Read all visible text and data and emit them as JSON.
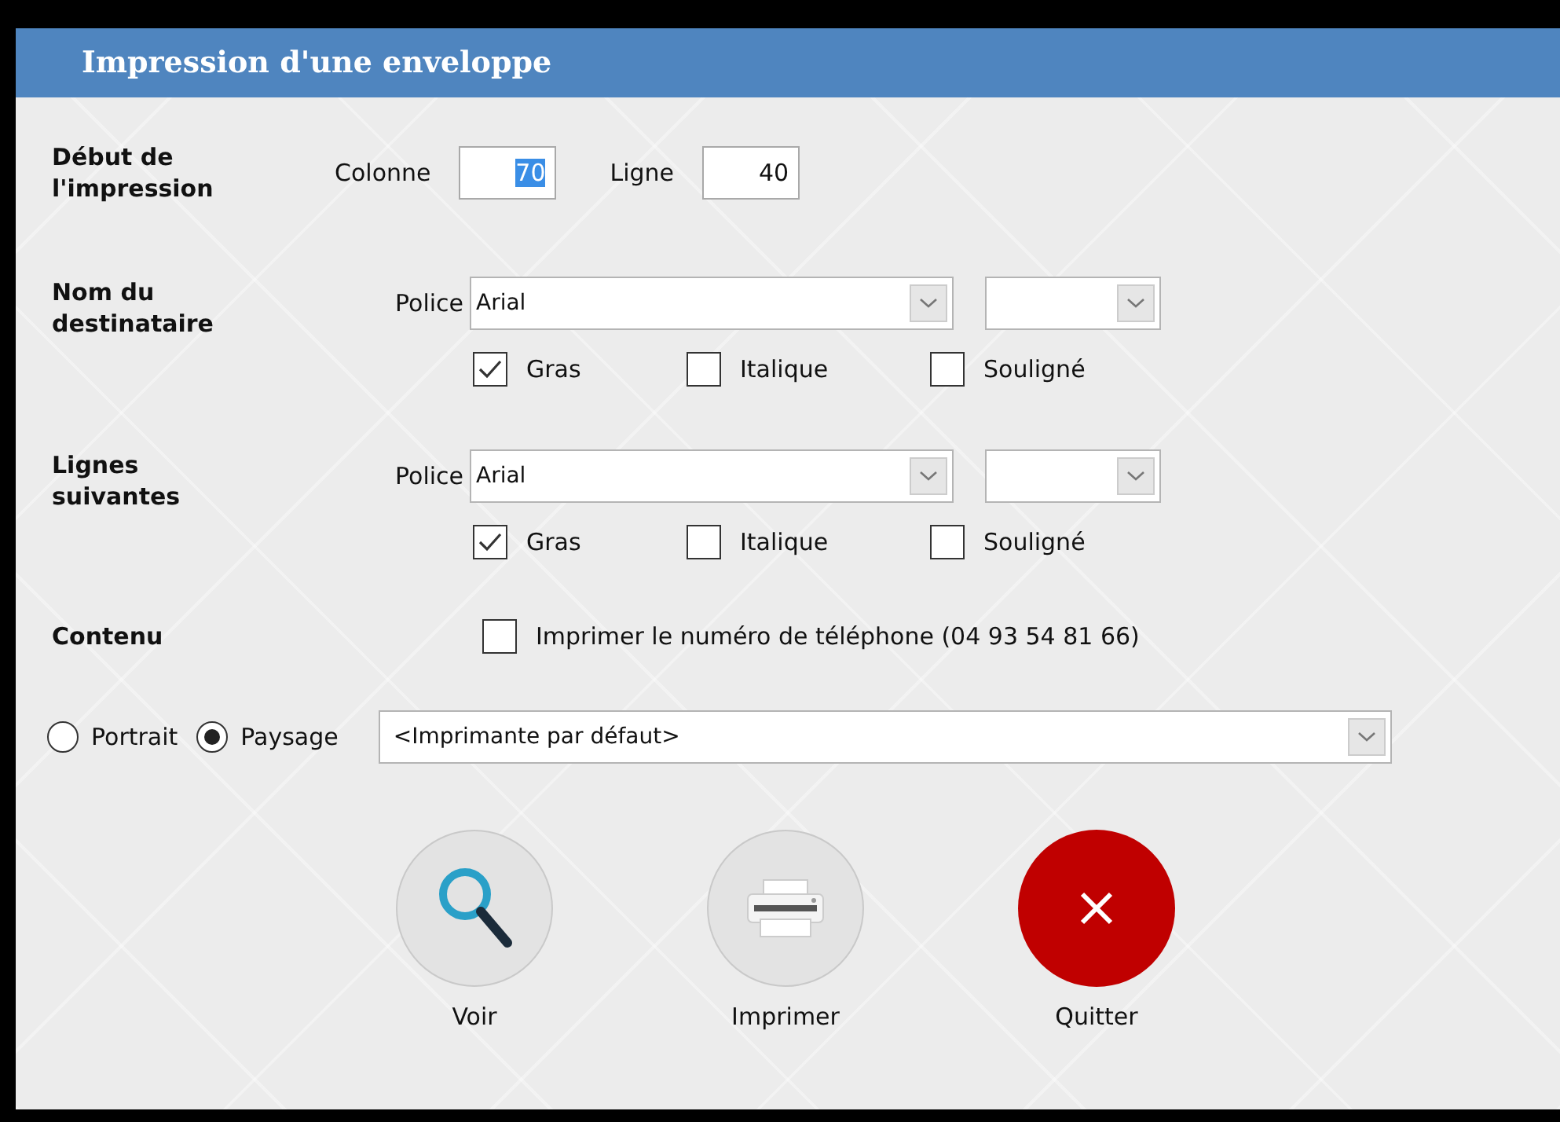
{
  "window": {
    "title": "Impression d'une enveloppe"
  },
  "start": {
    "label": "Début de l'impression",
    "fields": [
      {
        "label": "Colonne",
        "value": "70",
        "selected": true
      },
      {
        "label": "Ligne",
        "value": "40",
        "selected": false
      }
    ]
  },
  "font_groups": [
    {
      "label": "Nom du destinataire",
      "font_label": "Police",
      "font": "Arial",
      "checkboxes": [
        {
          "label": "Gras",
          "checked": true
        },
        {
          "label": "Italique",
          "checked": false
        },
        {
          "label": "Souligné",
          "checked": false
        }
      ]
    },
    {
      "label": "Lignes suivantes",
      "font_label": "Police",
      "font": "Arial",
      "checkboxes": [
        {
          "label": "Gras",
          "checked": true
        },
        {
          "label": "Italique",
          "checked": false
        },
        {
          "label": "Souligné",
          "checked": false
        }
      ]
    }
  ],
  "content": {
    "label": "Contenu",
    "checkbox": {
      "label": "Imprimer le numéro de téléphone (04 93 54 81 66)",
      "checked": false
    }
  },
  "orientation": [
    {
      "label": "Portrait",
      "selected": false
    },
    {
      "label": "Paysage",
      "selected": true
    }
  ],
  "printer": {
    "value": "<Imprimante par défaut>"
  },
  "buttons": [
    {
      "kind": "view",
      "label": "Voir"
    },
    {
      "kind": "print",
      "label": "Imprimer"
    },
    {
      "kind": "quit",
      "label": "Quitter"
    }
  ]
}
